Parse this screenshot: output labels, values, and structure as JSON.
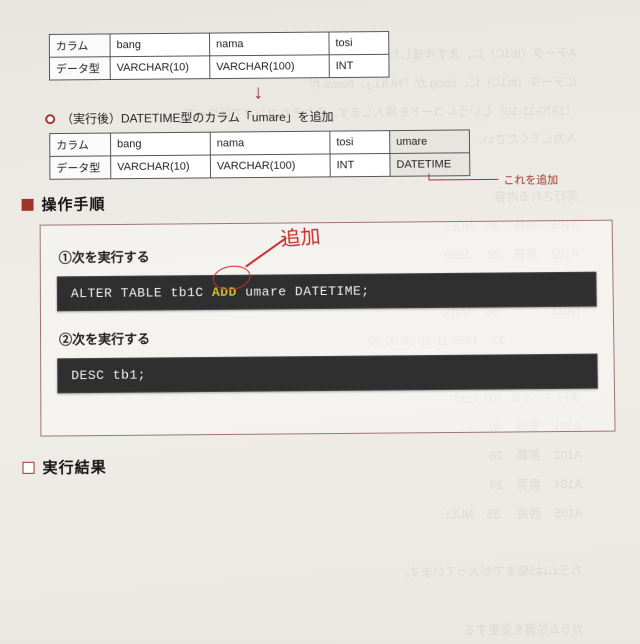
{
  "tables": {
    "row_label_col": "カラム",
    "row_label_type": "データ型",
    "before": {
      "cols": [
        "bang",
        "nama",
        "tosi"
      ],
      "types": [
        "VARCHAR(10)",
        "VARCHAR(100)",
        "INT"
      ]
    },
    "after": {
      "cols": [
        "bang",
        "nama",
        "tosi",
        "umare"
      ],
      "types": [
        "VARCHAR(10)",
        "VARCHAR(100)",
        "INT",
        "DATETIME"
      ]
    }
  },
  "arrow": "↓",
  "caption_after": "（実行後）DATETIME型のカラム「umare」を追加",
  "annotation_add": "これを追加",
  "section_procedure": "操作手順",
  "steps": {
    "s1_label": "①次を実行する",
    "s1_code_pre": "ALTER TABLE tb1C ",
    "s1_code_kw": "ADD",
    "s1_code_post": " umare DATETIME;",
    "s2_label": "②次を実行する",
    "s2_code": "DESC tb1;"
  },
  "handwritten": "追加",
  "section_result": "実行結果",
  "ghost_text": "Aデータ（tb1C）に、まず作成した\nにデータ（tb1C）に、bang が「NULL」、nama が\n（1970-11-10）というレコードを挿入します。それぞれカンマで区切って\n入力してください。\n\n実行される内容\nA101    壱岐    40    NULL\nA102    那覇    28     1999\nA104    奥羽    23    NULL\nNULL    　　    55    NULL\n　　    　　    33    1975-11-10 00:00:00\n\n実行ファイル（00_csv）\nA101    壱岐    40\nA102    那覇    28\nA104    奥羽    23\nA105    西海     35    NULL\n\nカラムは5個までが入っています。\n\nカラム位置を変更する\n\nA101    壱岐    40\nA102    那覇    28"
}
